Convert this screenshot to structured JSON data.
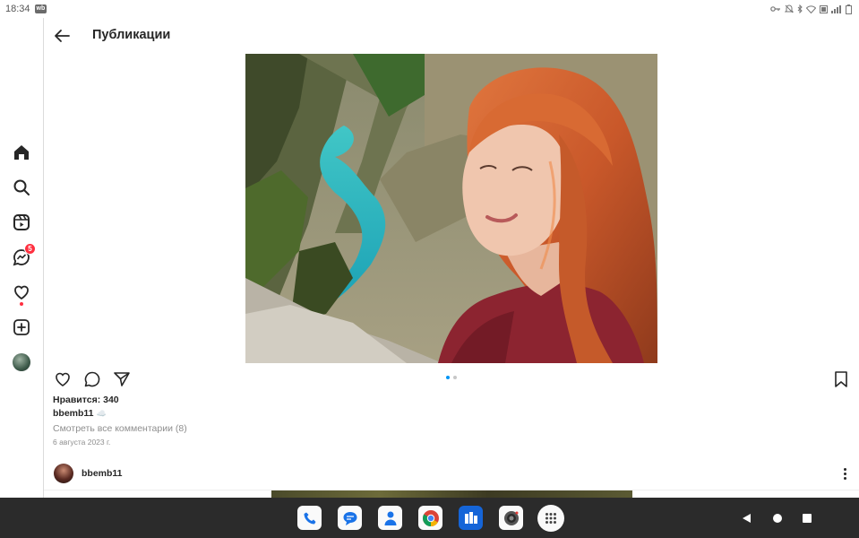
{
  "status_bar": {
    "time": "18:34",
    "badge": "wb"
  },
  "header": {
    "title": "Публикации"
  },
  "rail": {
    "messages_badge": "5"
  },
  "post": {
    "likes": "Нравится: 340",
    "caption_user": "bbemb11",
    "caption_emoji": "☁️",
    "comments_link": "Смотреть все комментарии (8)",
    "date": "6 августа 2023 г.",
    "carousel_count": 2,
    "carousel_active": 1
  },
  "next_post": {
    "username": "bbemb11"
  },
  "colors": {
    "accent": "#0095f6",
    "badge": "#ff3040",
    "taskbar": "#2b2b2b"
  },
  "taskbar_apps": [
    "phone-app",
    "messages-app",
    "contacts-app",
    "chrome-app",
    "files-app",
    "camera-app",
    "app-drawer"
  ]
}
